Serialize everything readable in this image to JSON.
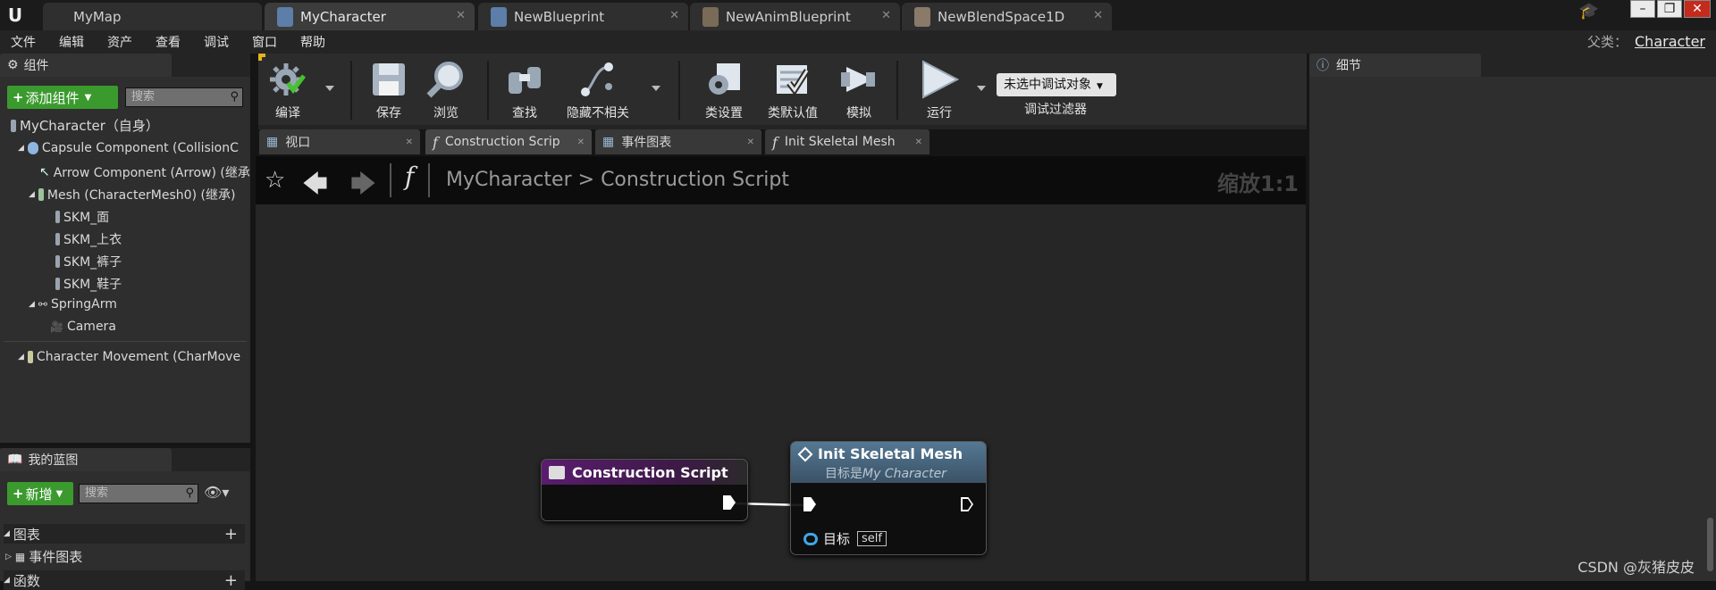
{
  "titlebar": {
    "tabs": [
      {
        "label": "MyMap",
        "active": false
      },
      {
        "label": "MyCharacter",
        "active": true
      },
      {
        "label": "NewBlueprint",
        "active": false
      },
      {
        "label": "NewAnimBlueprint",
        "active": false
      },
      {
        "label": "NewBlendSpace1D",
        "active": false
      }
    ]
  },
  "menu": {
    "items": [
      "文件",
      "编辑",
      "资产",
      "查看",
      "调试",
      "窗口",
      "帮助"
    ],
    "parent_label": "父类：",
    "parent_value": "Character"
  },
  "components_panel": {
    "title": "组件",
    "add_button": "添加组件",
    "search_placeholder": "搜索",
    "root": "MyCharacter（自身）",
    "items": [
      "Capsule Component (CollisionC",
      "Arrow Component (Arrow) (继承",
      "Mesh (CharacterMesh0) (继承)",
      "SKM_面",
      "SKM_上衣",
      "SKM_裤子",
      "SKM_鞋子",
      "SpringArm",
      "Camera",
      "Character Movement (CharMove"
    ]
  },
  "my_blueprint_panel": {
    "title": "我的蓝图",
    "new_button": "新增",
    "search_placeholder": "搜索",
    "sections": [
      "图表",
      "事件图表",
      "函数"
    ]
  },
  "toolbar": {
    "buttons": [
      "编译",
      "保存",
      "浏览",
      "查找",
      "隐藏不相关",
      "类设置",
      "类默认值",
      "模拟",
      "运行"
    ],
    "debug_dropdown": "未选中调试对象",
    "debug_filter_label": "调试过滤器"
  },
  "doc_tabs": [
    "视口",
    "Construction Scrip",
    "事件图表",
    "Init Skeletal Mesh"
  ],
  "graph": {
    "breadcrumb_root": "MyCharacter",
    "breadcrumb_separator": ">",
    "breadcrumb_current": "Construction Script",
    "zoom": "缩放1:1"
  },
  "nodes": {
    "construction": {
      "title": "Construction Script"
    },
    "init": {
      "title": "Init Skeletal Mesh",
      "subtitle_prefix": "目标是",
      "subtitle_target": "My Character",
      "pin_label": "目标",
      "pin_value": "self"
    }
  },
  "details_panel": {
    "title": "细节"
  },
  "watermark": "CSDN @灰猪皮皮",
  "colors": {
    "construction_header": "#5a1c6e",
    "init_header": "#4a6c86",
    "add_button": "#3a9a2e"
  }
}
